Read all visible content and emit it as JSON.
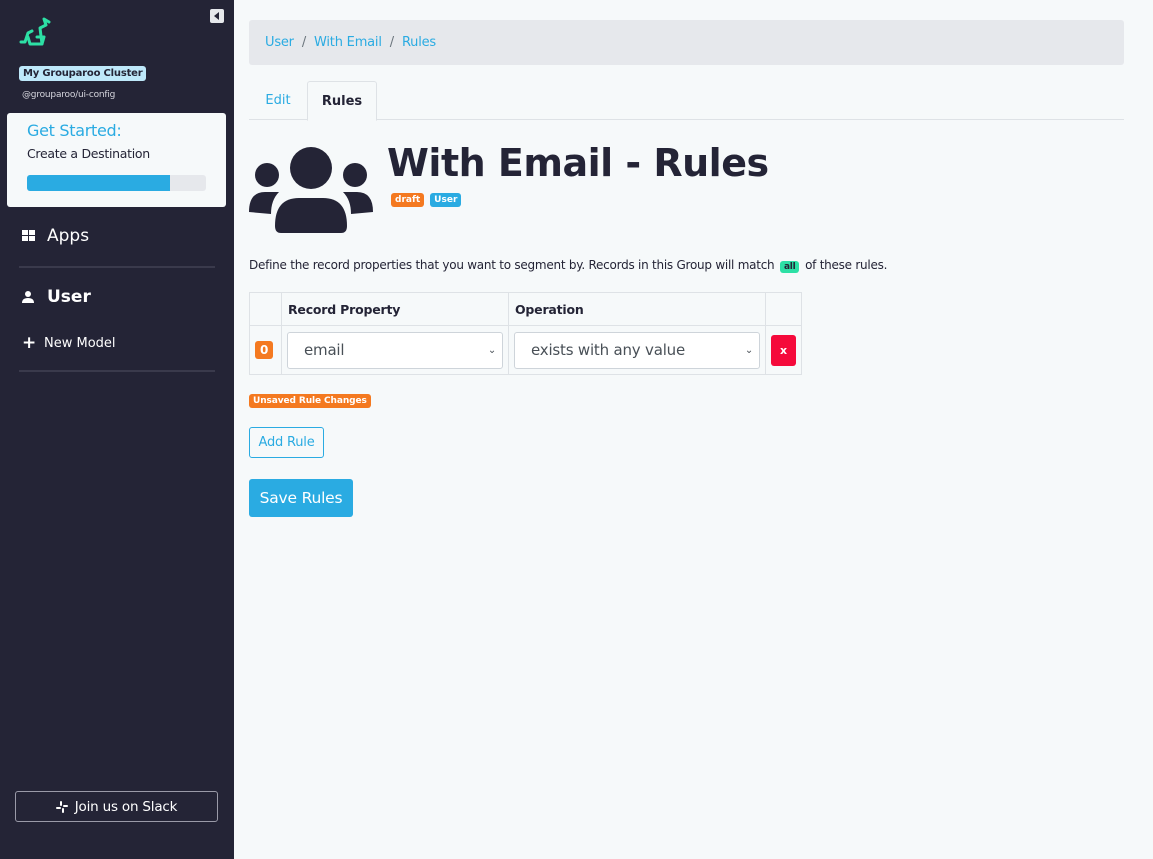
{
  "sidebar": {
    "cluster_name": "My Grouparoo Cluster",
    "cluster_sub": "@grouparoo/ui-config",
    "get_started": {
      "title": "Get Started:",
      "subtitle": "Create a Destination",
      "progress_percent": 80
    },
    "nav": {
      "apps": "Apps",
      "user": "User",
      "new_model": "New Model"
    },
    "slack_button": "Join us on Slack"
  },
  "breadcrumb": [
    "User",
    "With Email",
    "Rules"
  ],
  "breadcrumb_separator": "/",
  "tabs": [
    {
      "label": "Edit",
      "active": false
    },
    {
      "label": "Rules",
      "active": true
    }
  ],
  "header": {
    "title": "With Email - Rules",
    "badges": {
      "state": "draft",
      "model": "User"
    }
  },
  "description": {
    "before": "Define the record properties that you want to segment by. Records in this Group will match",
    "match": "all",
    "after": "of these rules."
  },
  "rules_table": {
    "columns": [
      "",
      "Record Property",
      "Operation",
      ""
    ],
    "rows": [
      {
        "index": "0",
        "property": "email",
        "operation": "exists with any value",
        "delete_label": "x"
      }
    ]
  },
  "unsaved_badge": "Unsaved Rule Changes",
  "buttons": {
    "add_rule": "Add Rule",
    "save_rules": "Save Rules"
  },
  "colors": {
    "primary": "#2aabe2",
    "sidebar_bg": "#242436",
    "warning": "#f47920",
    "danger": "#f50a3b",
    "success": "#2de0a5"
  }
}
